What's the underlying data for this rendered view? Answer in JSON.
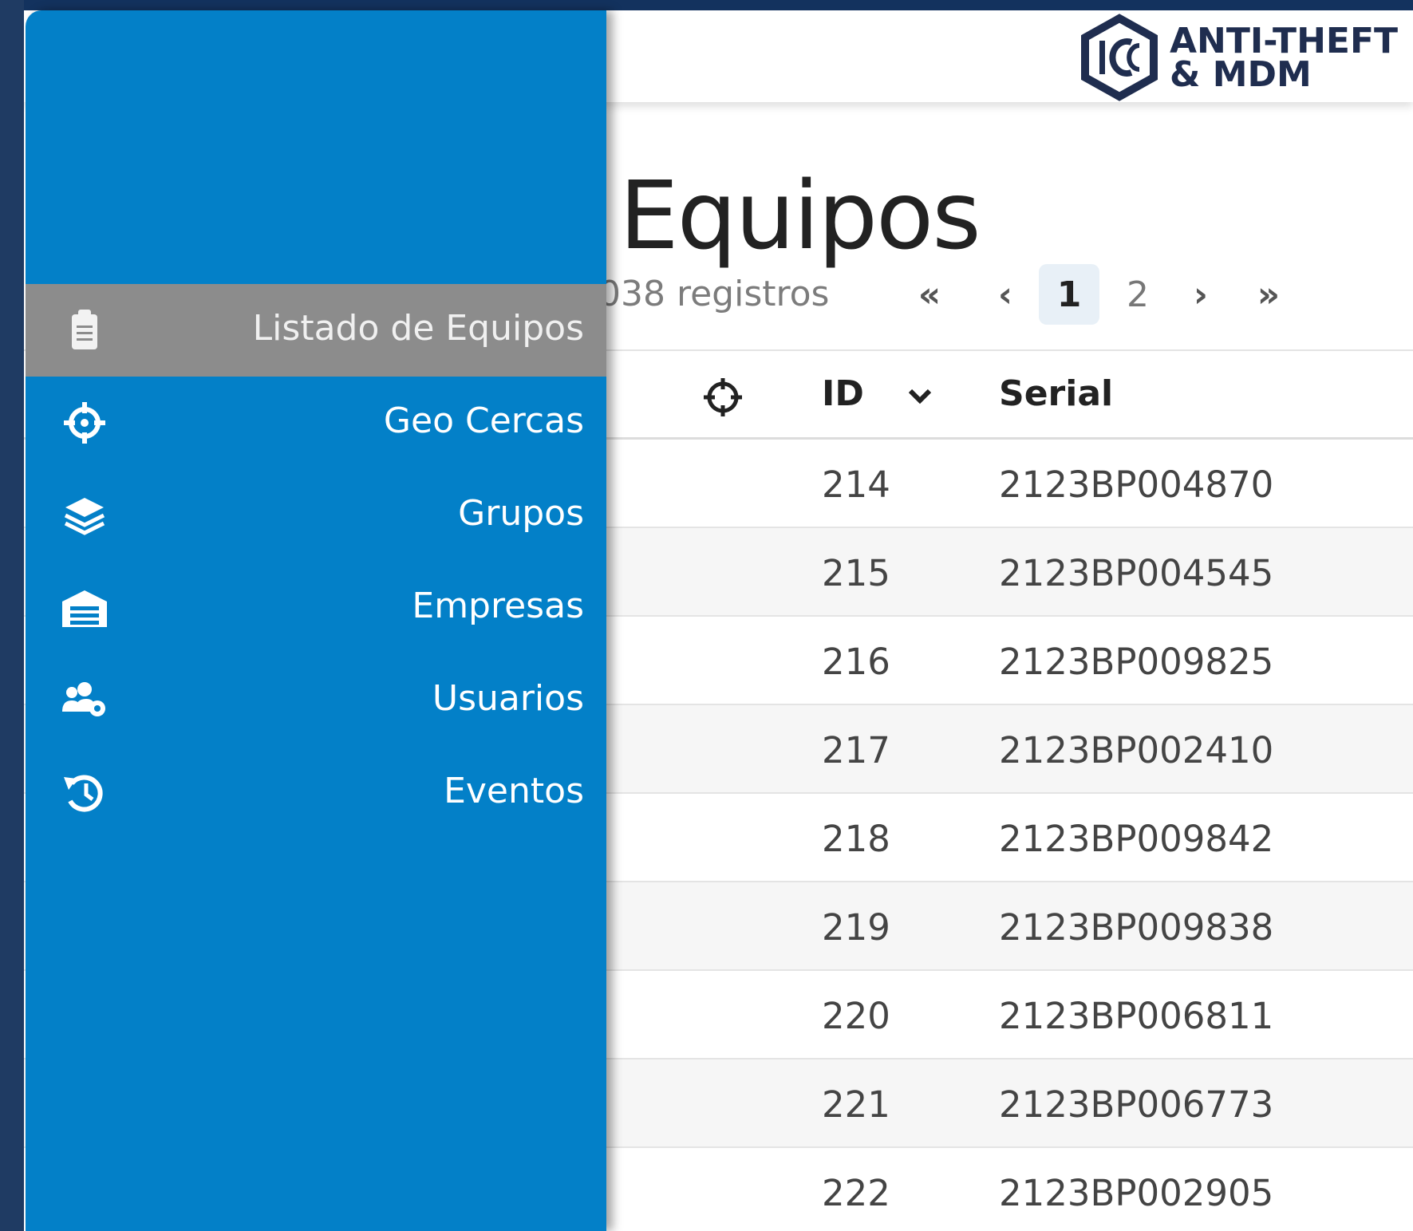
{
  "logo": {
    "line1": "ANTI-THEFT",
    "line2": "& MDM",
    "color": "#1f2d4f"
  },
  "page": {
    "title_visible": "e Equipos",
    "records_visible": "038 registros"
  },
  "pagination": {
    "first": "«",
    "prev": "‹",
    "current": "1",
    "page2": "2",
    "next": "›",
    "last": "»"
  },
  "table": {
    "headers": {
      "locate_icon": "crosshair-icon",
      "id": "ID",
      "serial": "Serial"
    },
    "rows": [
      {
        "id": "214",
        "serial": "2123BP004870"
      },
      {
        "id": "215",
        "serial": "2123BP004545"
      },
      {
        "id": "216",
        "serial": "2123BP009825"
      },
      {
        "id": "217",
        "serial": "2123BP002410"
      },
      {
        "id": "218",
        "serial": "2123BP009842"
      },
      {
        "id": "219",
        "serial": "2123BP009838"
      },
      {
        "id": "220",
        "serial": "2123BP006811"
      },
      {
        "id": "221",
        "serial": "2123BP006773"
      },
      {
        "id": "222",
        "serial": "2123BP002905"
      }
    ]
  },
  "sidebar": {
    "accent": "#0380c8",
    "active_bg": "#8c8c8c",
    "items": [
      {
        "label": "Listado de Equipos",
        "icon": "clipboard-icon",
        "active": true
      },
      {
        "label": "Geo Cercas",
        "icon": "crosshair-icon",
        "active": false
      },
      {
        "label": "Grupos",
        "icon": "layers-icon",
        "active": false
      },
      {
        "label": "Empresas",
        "icon": "warehouse-icon",
        "active": false
      },
      {
        "label": "Usuarios",
        "icon": "users-gear-icon",
        "active": false
      },
      {
        "label": "Eventos",
        "icon": "history-icon",
        "active": false
      }
    ]
  }
}
